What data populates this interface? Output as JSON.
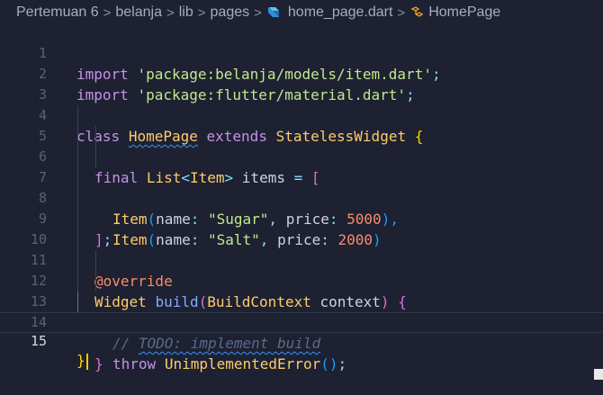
{
  "breadcrumb": {
    "items": [
      "Pertemuan 6",
      "belanja",
      "lib",
      "pages"
    ],
    "file": "home_page.dart",
    "symbol": "HomePage",
    "separator": ">",
    "file_icon": "dart-icon",
    "symbol_icon": "class-symbol-icon"
  },
  "editor": {
    "current_line": "15",
    "line_numbers": [
      "1",
      "2",
      "3",
      "4",
      "5",
      "6",
      "7",
      "8",
      "9",
      "10",
      "11",
      "12",
      "13",
      "14",
      "15"
    ],
    "tokens": {
      "l1": [
        "import",
        "'package:belanja/models/item.dart'",
        ";"
      ],
      "l2": [
        "import",
        "'package:flutter/material.dart'",
        ";"
      ],
      "l4": [
        "class",
        "HomePage",
        "extends",
        "StatelessWidget",
        "{"
      ],
      "l5": [
        "final",
        "List",
        "<",
        "Item",
        ">",
        "items",
        "=",
        "["
      ],
      "l6": [
        "Item",
        "(",
        "name",
        ":",
        "\"Sugar\"",
        ",",
        "price",
        ":",
        "5000",
        "),"
      ],
      "l7": [
        "Item",
        "(",
        "name",
        ":",
        "\"Salt\"",
        ",",
        "price",
        ":",
        "2000",
        ")"
      ],
      "l8": [
        "]",
        ";"
      ],
      "l10": [
        "@override"
      ],
      "l11": [
        "Widget",
        "build",
        "(",
        "BuildContext",
        "context",
        ")",
        "{"
      ],
      "l12": [
        "// ",
        "TODO: implement build"
      ],
      "l13": [
        "throw",
        "UnimplementedError",
        "()",
        ";"
      ],
      "l14": [
        "}"
      ],
      "l15": [
        "}"
      ]
    }
  },
  "colors": {
    "background": "#1d2131",
    "keyword": "#c792ea",
    "string": "#c3e88d",
    "type": "#ffcb6b",
    "function": "#82aaff",
    "number": "#f78c6c",
    "punctuation": "#89ddff",
    "squiggle": "#3794ff",
    "caret": "#ffcc00"
  }
}
